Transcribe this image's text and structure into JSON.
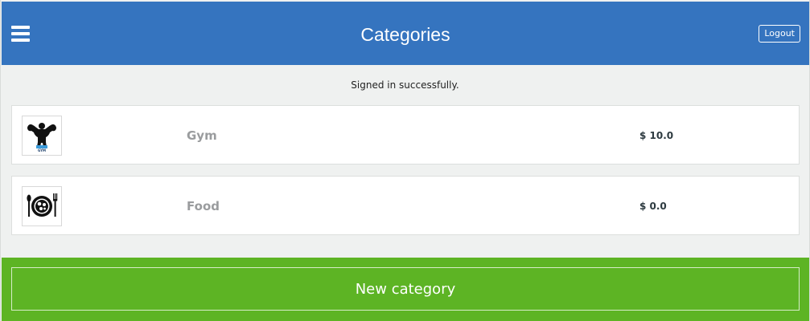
{
  "header": {
    "title": "Categories",
    "logout_label": "Logout",
    "menu_icon": "hamburger-menu-icon",
    "background_color": "#3574bf"
  },
  "flash": {
    "message": "Signed in successfully."
  },
  "categories": [
    {
      "name": "Gym",
      "amount": "$ 10.0",
      "icon": "gym-bodybuilder-icon",
      "logo_text": "GYM"
    },
    {
      "name": "Food",
      "amount": "$ 0.0",
      "icon": "food-plate-icon"
    }
  ],
  "footer": {
    "new_category_label": "New category",
    "background_color": "#5db424"
  }
}
